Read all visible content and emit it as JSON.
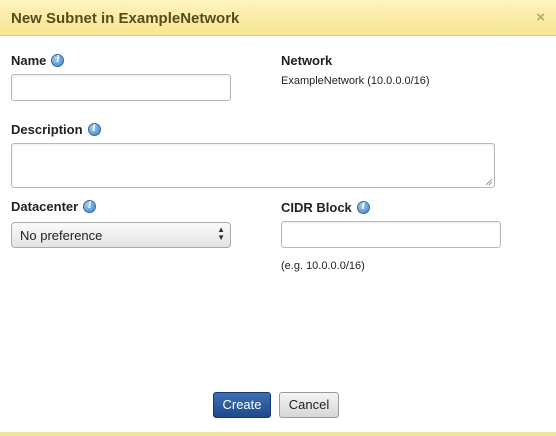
{
  "dialog": {
    "title": "New Subnet in ExampleNetwork",
    "close_glyph": "×",
    "close_icon": "close-icon"
  },
  "fields": {
    "name": {
      "label": "Name",
      "value": "",
      "placeholder": ""
    },
    "network": {
      "label": "Network",
      "value": "ExampleNetwork (10.0.0.0/16)"
    },
    "description": {
      "label": "Description",
      "value": "",
      "placeholder": ""
    },
    "datacenter": {
      "label": "Datacenter",
      "selected": "No preference"
    },
    "cidr": {
      "label": "CIDR Block",
      "value": "",
      "placeholder": "",
      "hint": "(e.g. 10.0.0.0/16)"
    }
  },
  "info_icon": {
    "glyph": "i",
    "name": "info-icon"
  },
  "buttons": {
    "create": "Create",
    "cancel": "Cancel"
  },
  "colors": {
    "titlebar": "#f8e58f",
    "primary": "#1e4a8c"
  }
}
